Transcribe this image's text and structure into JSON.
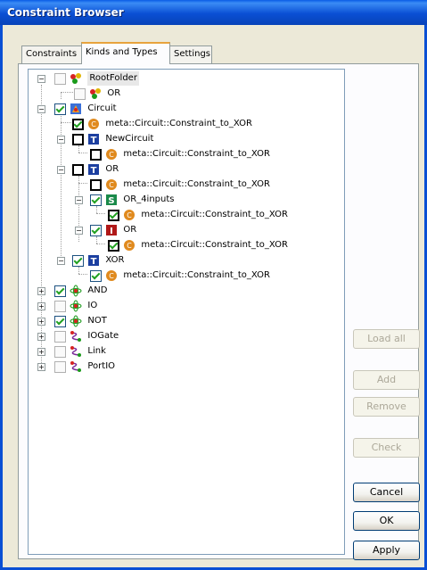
{
  "window": {
    "title": "Constraint Browser"
  },
  "tabs": [
    {
      "label": "Constraints",
      "active": false
    },
    {
      "label": "Kinds and Types",
      "active": true
    },
    {
      "label": "Settings",
      "active": false
    }
  ],
  "tree": {
    "items": [
      {
        "label": "RootFolder",
        "icon": "folder-icon",
        "checkbox": "unchecked-gray",
        "expander": "minus",
        "selected": true
      },
      {
        "label": "OR",
        "icon": "folder-icon",
        "checkbox": "unchecked-gray"
      },
      {
        "label": "Circuit",
        "icon": "model-icon",
        "checkbox": "checked",
        "expander": "minus"
      },
      {
        "label": "meta::Circuit::Constraint_to_XOR",
        "icon": "constraint-icon",
        "checkbox": "checked-bold"
      },
      {
        "label": "NewCircuit",
        "icon": "type-icon",
        "checkbox": "unchecked-bold",
        "expander": "minus"
      },
      {
        "label": "meta::Circuit::Constraint_to_XOR",
        "icon": "constraint-icon",
        "checkbox": "unchecked-bold"
      },
      {
        "label": "OR",
        "icon": "type-icon",
        "checkbox": "unchecked-bold",
        "expander": "minus"
      },
      {
        "label": "meta::Circuit::Constraint_to_XOR",
        "icon": "constraint-icon",
        "checkbox": "unchecked-bold"
      },
      {
        "label": "OR_4inputs",
        "icon": "subtype-icon",
        "checkbox": "checked",
        "expander": "minus"
      },
      {
        "label": "meta::Circuit::Constraint_to_XOR",
        "icon": "constraint-icon",
        "checkbox": "checked-bold"
      },
      {
        "label": "OR",
        "icon": "instance-icon",
        "checkbox": "checked",
        "expander": "minus"
      },
      {
        "label": "meta::Circuit::Constraint_to_XOR",
        "icon": "constraint-icon",
        "checkbox": "checked-bold"
      },
      {
        "label": "XOR",
        "icon": "type-icon",
        "checkbox": "checked",
        "expander": "minus"
      },
      {
        "label": "meta::Circuit::Constraint_to_XOR",
        "icon": "constraint-icon",
        "checkbox": "checked"
      },
      {
        "label": "AND",
        "icon": "atom-icon",
        "checkbox": "checked",
        "expander": "plus"
      },
      {
        "label": "IO",
        "icon": "atom-icon",
        "checkbox": "unchecked-gray",
        "expander": "plus"
      },
      {
        "label": "NOT",
        "icon": "atom-icon",
        "checkbox": "checked",
        "expander": "plus"
      },
      {
        "label": "IOGate",
        "icon": "connection-icon",
        "checkbox": "unchecked-gray",
        "expander": "plus"
      },
      {
        "label": "Link",
        "icon": "connection-icon",
        "checkbox": "unchecked-gray",
        "expander": "plus"
      },
      {
        "label": "PortIO",
        "icon": "connection-icon",
        "checkbox": "unchecked-gray",
        "expander": "plus"
      }
    ]
  },
  "buttons": {
    "load_all": "Load all",
    "add": "Add",
    "remove": "Remove",
    "check": "Check",
    "cancel": "Cancel",
    "ok": "OK",
    "apply": "Apply"
  },
  "colors": {
    "title_bar": "#0a4fd4",
    "background": "#ece9d8",
    "selection": "#e8e8e8",
    "check": "#21a121"
  }
}
